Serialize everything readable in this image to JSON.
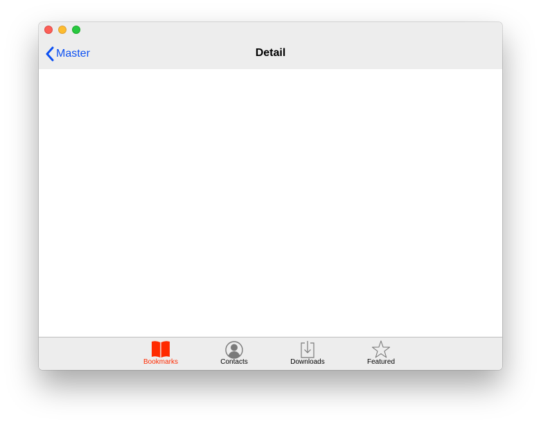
{
  "window": {
    "nav_bar": {
      "back_label": "Master",
      "title": "Detail"
    },
    "tab_bar": {
      "selected_index": 0,
      "tabs": [
        {
          "label": "Bookmarks",
          "icon": "bookmarks-icon"
        },
        {
          "label": "Contacts",
          "icon": "contacts-icon"
        },
        {
          "label": "Downloads",
          "icon": "downloads-icon"
        },
        {
          "label": "Featured",
          "icon": "featured-icon"
        }
      ]
    }
  },
  "colors": {
    "accent": "#0b4ff2",
    "selected_tab": "#ff2a00",
    "bar_background": "#ededed"
  }
}
